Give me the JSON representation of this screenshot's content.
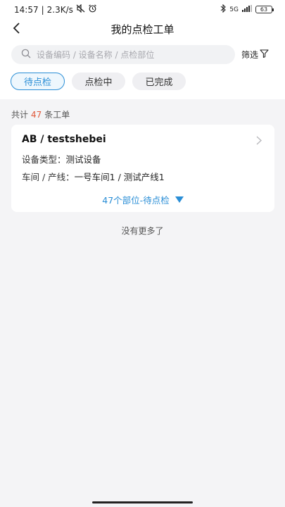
{
  "status_bar": {
    "time": "14:57",
    "speed": "2.3K/s",
    "battery": "63",
    "network": "5G"
  },
  "nav": {
    "title": "我的点检工单"
  },
  "search": {
    "placeholder": "设备编码 / 设备名称 / 点检部位",
    "value": ""
  },
  "filter": {
    "label": "筛选"
  },
  "tabs": [
    {
      "label": "待点检",
      "active": true
    },
    {
      "label": "点检中",
      "active": false
    },
    {
      "label": "已完成",
      "active": false
    }
  ],
  "summary": {
    "prefix": "共计",
    "count": "47",
    "suffix": "条工单"
  },
  "orders": [
    {
      "title": "AB / testshebei",
      "type_label": "设备类型：",
      "type_value": "测试设备",
      "line_label": "车间 / 产线：",
      "line_value": "一号车间1 / 测试产线1",
      "expand_label": "47个部位-待点检"
    }
  ],
  "footer": {
    "no_more": "没有更多了"
  },
  "colors": {
    "accent": "#2a8ed6",
    "count_highlight": "#e0583a",
    "background": "#f4f4f6"
  }
}
